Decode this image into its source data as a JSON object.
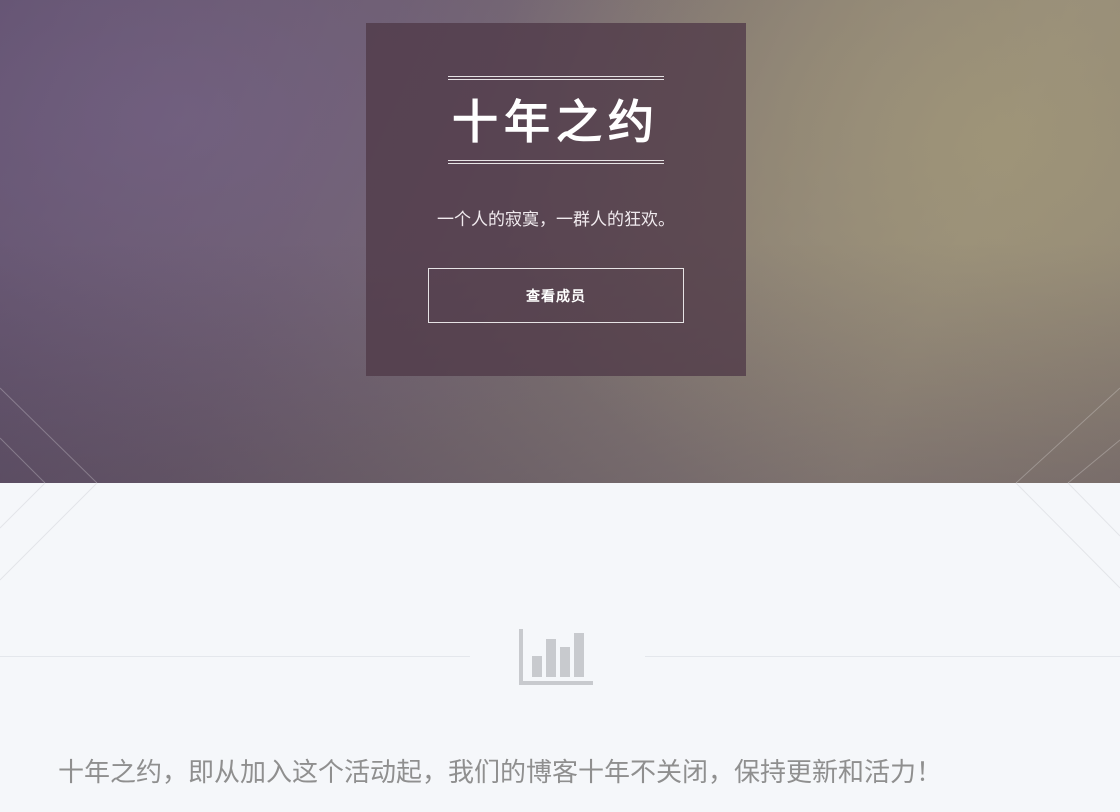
{
  "hero": {
    "title": "十年之约",
    "subtitle": "一个人的寂寞，一群人的狂欢。",
    "cta_label": "查看成员"
  },
  "section": {
    "icon": "bar-chart-icon",
    "text": "十年之约，即从加入这个活动起，我们的博客十年不关闭，保持更新和活力！"
  },
  "colors": {
    "page_background": "#f5f7fa",
    "card_background": "#503a48",
    "text_gray": "#8f8f8f",
    "icon_gray": "#c8cace"
  }
}
